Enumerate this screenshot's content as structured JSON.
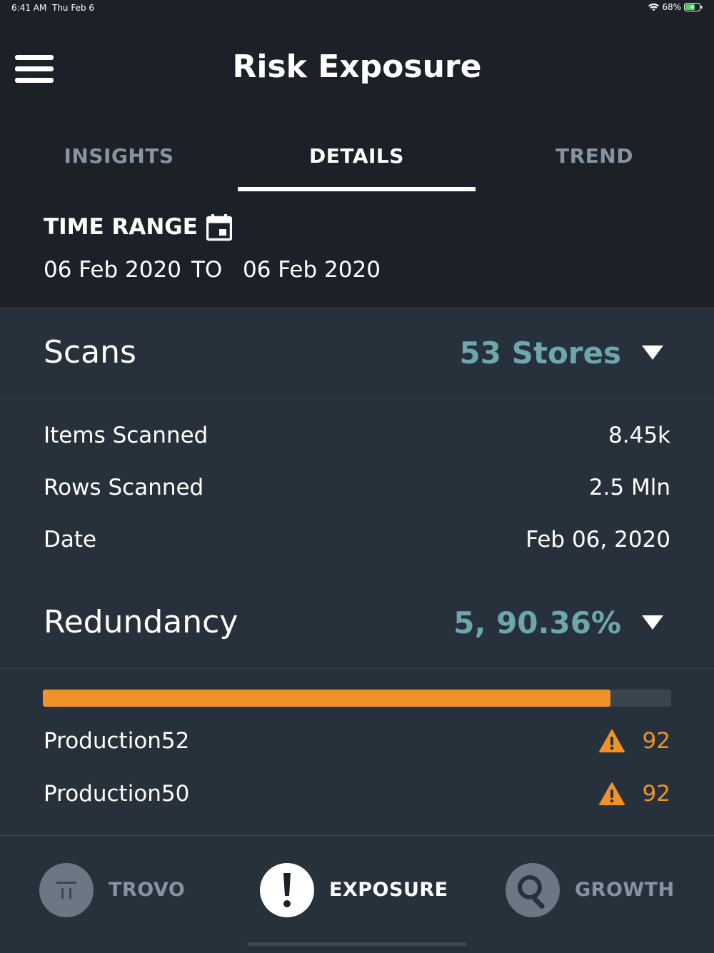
{
  "status_bar": {
    "time": "6:41 AM",
    "date": "Thu Feb 6",
    "battery": "68%"
  },
  "header": {
    "title": "Risk Exposure"
  },
  "tabs": [
    {
      "label": "INSIGHTS",
      "active": false
    },
    {
      "label": "DETAILS",
      "active": true
    },
    {
      "label": "TREND",
      "active": false
    }
  ],
  "time_range": {
    "label": "TIME RANGE",
    "from": "06 Feb 2020",
    "separator": "TO",
    "to": "06 Feb 2020"
  },
  "scans": {
    "title": "Scans",
    "value": "53 Stores",
    "rows": [
      {
        "label": "Items Scanned",
        "value": "8.45k"
      },
      {
        "label": "Rows Scanned",
        "value": "2.5 Mln"
      },
      {
        "label": "Date",
        "value": "Feb 06, 2020"
      }
    ]
  },
  "redundancy": {
    "title": "Redundancy",
    "value": "5, 90.36%",
    "progress_fraction": 0.9036,
    "items": [
      {
        "label": "Production52",
        "value": "92"
      },
      {
        "label": "Production50",
        "value": "92"
      }
    ]
  },
  "bottom_nav": [
    {
      "label": "TROVO",
      "icon": "trovo-icon",
      "active": false
    },
    {
      "label": "EXPOSURE",
      "icon": "exclamation-icon",
      "active": true
    },
    {
      "label": "GROWTH",
      "icon": "magnifier-icon",
      "active": false
    }
  ],
  "colors": {
    "accent": "#6da7ad",
    "warning": "#f0922a",
    "background": "#1c2128",
    "panel": "#27313b",
    "inactive": "#8693a0"
  }
}
